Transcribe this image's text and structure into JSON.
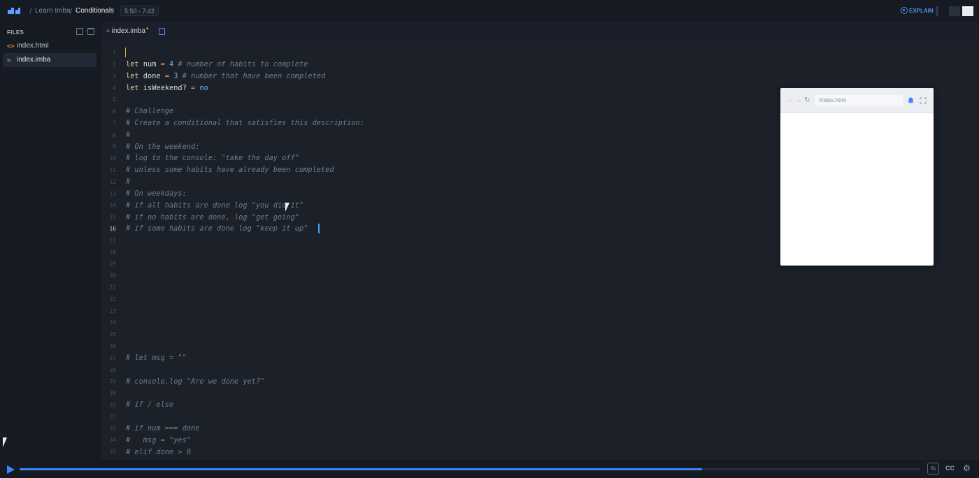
{
  "header": {
    "breadcrumb": [
      "Learn Imba",
      "Conditionals"
    ],
    "separator": "/",
    "timer": "5:50 · 7:42",
    "explain_label": "EXPLAIN",
    "accent": "#3a86ff"
  },
  "sidebar": {
    "title": "FILES",
    "files": [
      {
        "name": "index.html",
        "icon": "html-file-icon",
        "icon_glyph": "<>"
      },
      {
        "name": "index.imba",
        "icon": "imba-file-icon",
        "icon_glyph": "≡",
        "active": true
      }
    ]
  },
  "editor": {
    "tab_label": "index.imba",
    "tab_modified": "•",
    "active_line": 16,
    "lines": [
      {
        "n": "1"
      },
      {
        "n": "2"
      },
      {
        "n": "3"
      },
      {
        "n": "4"
      },
      {
        "n": "5"
      },
      {
        "n": "6"
      },
      {
        "n": "7"
      },
      {
        "n": "8"
      },
      {
        "n": "9"
      },
      {
        "n": "10"
      },
      {
        "n": "11"
      },
      {
        "n": "12"
      },
      {
        "n": "13"
      },
      {
        "n": "14"
      },
      {
        "n": "15"
      },
      {
        "n": "16"
      },
      {
        "n": "17"
      },
      {
        "n": "18"
      },
      {
        "n": "19"
      },
      {
        "n": "20"
      },
      {
        "n": "21"
      },
      {
        "n": "22"
      },
      {
        "n": "23"
      },
      {
        "n": "24"
      },
      {
        "n": "25"
      },
      {
        "n": "26"
      },
      {
        "n": "27"
      },
      {
        "n": "28"
      },
      {
        "n": "29"
      },
      {
        "n": "30"
      },
      {
        "n": "31"
      },
      {
        "n": "32"
      },
      {
        "n": "33"
      },
      {
        "n": "34"
      },
      {
        "n": "35"
      }
    ],
    "code": {
      "l1": {
        "kw": "let",
        "name": " num ",
        "op": "=",
        "num": " 4",
        "comment": " # number of habits to complete"
      },
      "l2": {
        "kw": "let",
        "name": " done ",
        "op": "=",
        "num": " 3",
        "comment": " # number that have been completed"
      },
      "l3": {
        "kw": "let",
        "name": " isWeekend? ",
        "op": "=",
        "bool": " no"
      },
      "l6": "# Challenge",
      "l7": "# Create a conditional that satisfies this description:",
      "l8": "#",
      "l9": "# On the weekend:",
      "l10": "# log to the console: \"take the day off\"",
      "l11": "# unless some habits have already been completed",
      "l12": "#",
      "l13": "# On weekdays:",
      "l14": "# if all habits are done log \"you did it\"",
      "l15": "# if no habits are done, log \"get going\"",
      "l16": "# if some habits are done log \"keep it up\"",
      "l27": "# let msg = \"\"",
      "l29": "# console.log \"Are we done yet?\"",
      "l31": "# if / else",
      "l33": "# if num === done",
      "l34": "#   msg = \"yes\"",
      "l35": "# elif done > 0"
    }
  },
  "preview": {
    "url": "/index.html",
    "back_icon": "←",
    "forward_icon": "→",
    "reload_icon": "↻",
    "bell_icon": "bell-icon",
    "expand_icon": "expand-icon"
  },
  "player": {
    "progress": 0.758,
    "speed_label": "⅔",
    "cc_label": "CC",
    "settings_icon": "⚙"
  }
}
